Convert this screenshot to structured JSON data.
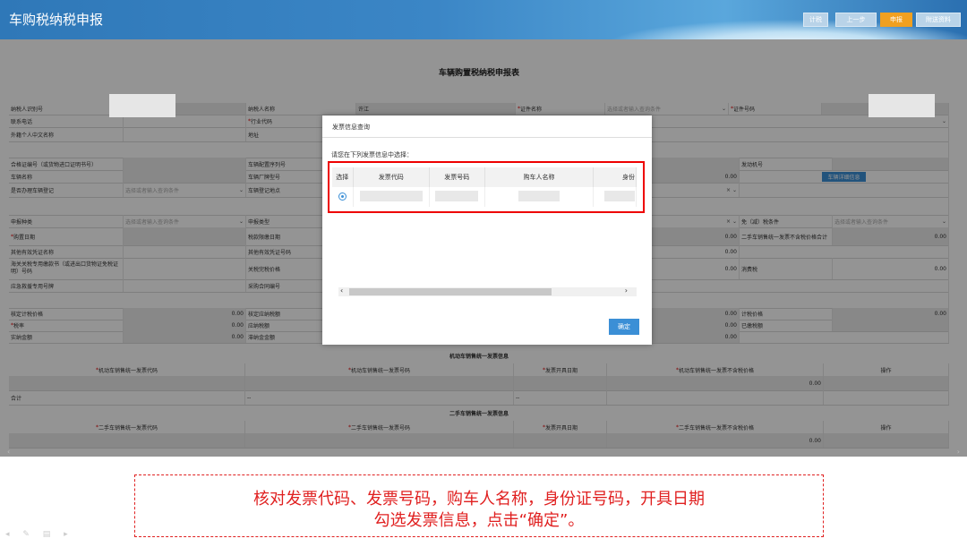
{
  "header": {
    "app_title": "车购税纳税申报",
    "buttons": {
      "calc": "计税",
      "prev": "上一步",
      "submit": "申报",
      "attach": "附送资料"
    }
  },
  "form": {
    "title": "车辆购置税纳税申报表",
    "labels": {
      "taxpayer_id": "纳税人识别号",
      "taxpayer_name": "纳税人名称",
      "taxpayer_name_value": "许江",
      "cert_name": "证件名称",
      "cert_no": "证件号码",
      "phone": "联系电话",
      "industry": "行业代码",
      "foreign_name": "外籍个人中文名称",
      "address": "地址",
      "cert_no2": "合格证编号（或货物进口证明书号）",
      "config_no": "车辆配置序列号",
      "engine_no": "发动机号",
      "vehicle_name": "车辆名称",
      "factory_model": "车辆厂牌型号",
      "vehicle_detail_btn": "车辆详细信息",
      "register": "是否办理车辆登记",
      "register_place": "车辆登记地点",
      "declare_type": "申报种类",
      "report_type": "申报类型",
      "exemption": "免（减）税条件",
      "purchase_date": "购置日期",
      "tax_date": "税款限缴日期",
      "used_invoice_price": "二手车销售统一发票不含税价格合计",
      "other_cert": "其他有效凭证名称",
      "other_cert_no": "其他有效凭证号码",
      "customs_cert": "海关关税专用缴款书（或进出口货物证免税证明）号码",
      "customs_price": "关税完税价格",
      "consumption_tax": "消费税",
      "emergency_no": "应急救援专用号牌",
      "contract_no": "采购合同编号",
      "verified_price": "核定计税价格",
      "verified_tax": "核定应纳税额",
      "calc_price": "计税价格",
      "tax_rate": "税率",
      "tax_payable": "应纳税额",
      "paid_tax": "已缴税额",
      "actual_amount": "实纳金额",
      "late_fee": "滞纳金金额"
    },
    "placeholder": "选择或者输入查询条件",
    "zero": "0.00",
    "motor_section": {
      "title": "机动车销售统一发票信息",
      "headers": [
        "机动车销售统一发票代码",
        "机动车销售统一发票号码",
        "发票开具日期",
        "机动车销售统一发票不含税价格",
        "操作"
      ],
      "subtotal": "0.00",
      "sum_label": "合计",
      "dash": "--"
    },
    "used_section": {
      "title": "二手车销售统一发票信息",
      "headers": [
        "二手车销售统一发票代码",
        "二手车销售统一发票号码",
        "发票开具日期",
        "二手车销售统一发票不含税价格",
        "操作"
      ],
      "subtotal": "0.00"
    }
  },
  "modal": {
    "title": "发票信息查询",
    "prompt": "请您在下列发票信息中选择：",
    "columns": [
      "选择",
      "发票代码",
      "发票号码",
      "购车人名称",
      "身份"
    ],
    "confirm": "确定"
  },
  "caption": {
    "line1": "核对发票代码、发票号码，购车人名称，身份证号码，开具日期",
    "line2": "勾选发票信息，点击“确定”。"
  },
  "colors": {
    "header_blue": "#3b86c6",
    "active_orange": "#f0a020",
    "highlight_red": "#e00000",
    "button_blue": "#3b8fd6"
  }
}
